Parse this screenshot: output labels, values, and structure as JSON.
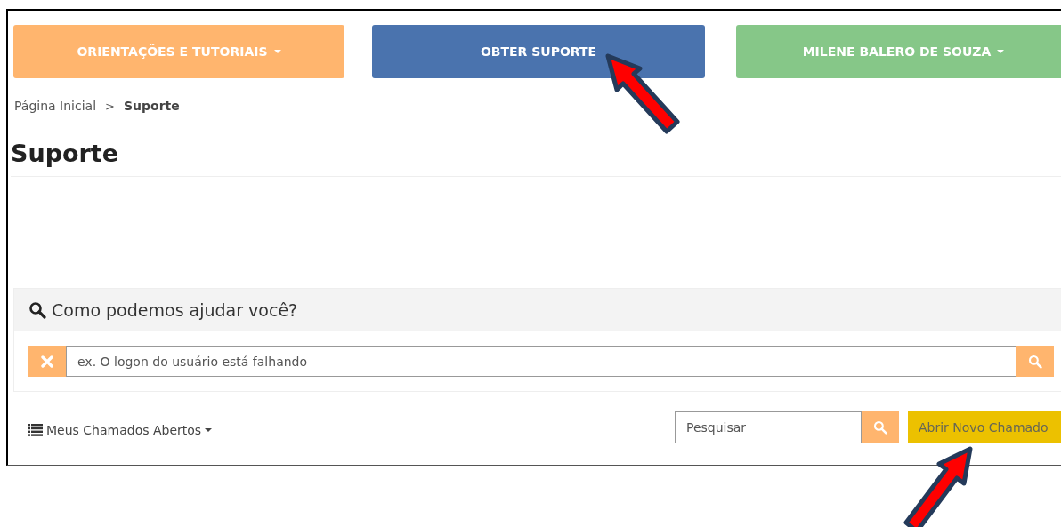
{
  "nav_buttons": [
    {
      "label": "ORIENTAÇÕES E TUTORIAIS",
      "color": "#ffb56e",
      "dropdown": true
    },
    {
      "label": "OBTER SUPORTE",
      "color": "#4a73ae",
      "dropdown": false
    },
    {
      "label": "MILENE BALERO DE SOUZA",
      "color": "#86c788",
      "dropdown": true
    }
  ],
  "breadcrumb": [
    {
      "label": "Página Inicial",
      "current": false
    },
    {
      "label": "Suporte",
      "current": true
    }
  ],
  "breadcrumb_separator": ">",
  "page_title": "Suporte",
  "help_panel": {
    "heading": "Como podemos ajudar você?",
    "search": {
      "placeholder": "ex. O logon do usuário está falhando"
    }
  },
  "tickets_menu": {
    "label": "Meus Chamados Abertos"
  },
  "tickets_search": {
    "placeholder": "Pesquisar"
  },
  "new_ticket_button": {
    "label": "Abrir Novo Chamado"
  }
}
